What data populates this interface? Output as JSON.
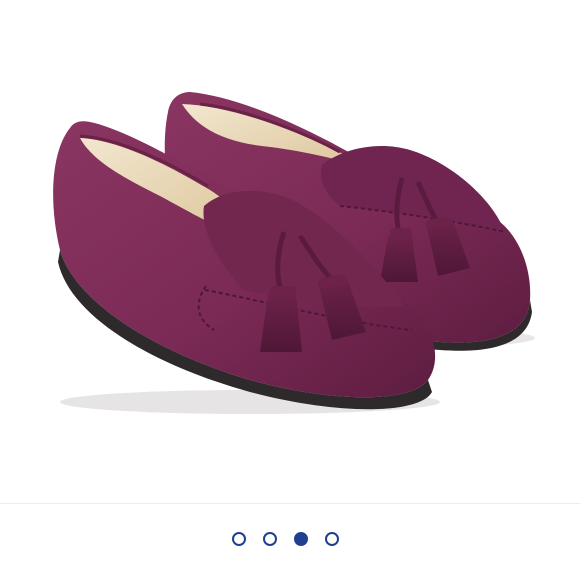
{
  "gallery": {
    "image_alt": "",
    "image_subject": "purple-suede-tassel-loafers",
    "colors": {
      "background": "#ffffff",
      "product": "#7b2a55",
      "indicator": "#1f3f8f"
    },
    "pagination": {
      "total": 4,
      "active_index": 2
    }
  }
}
